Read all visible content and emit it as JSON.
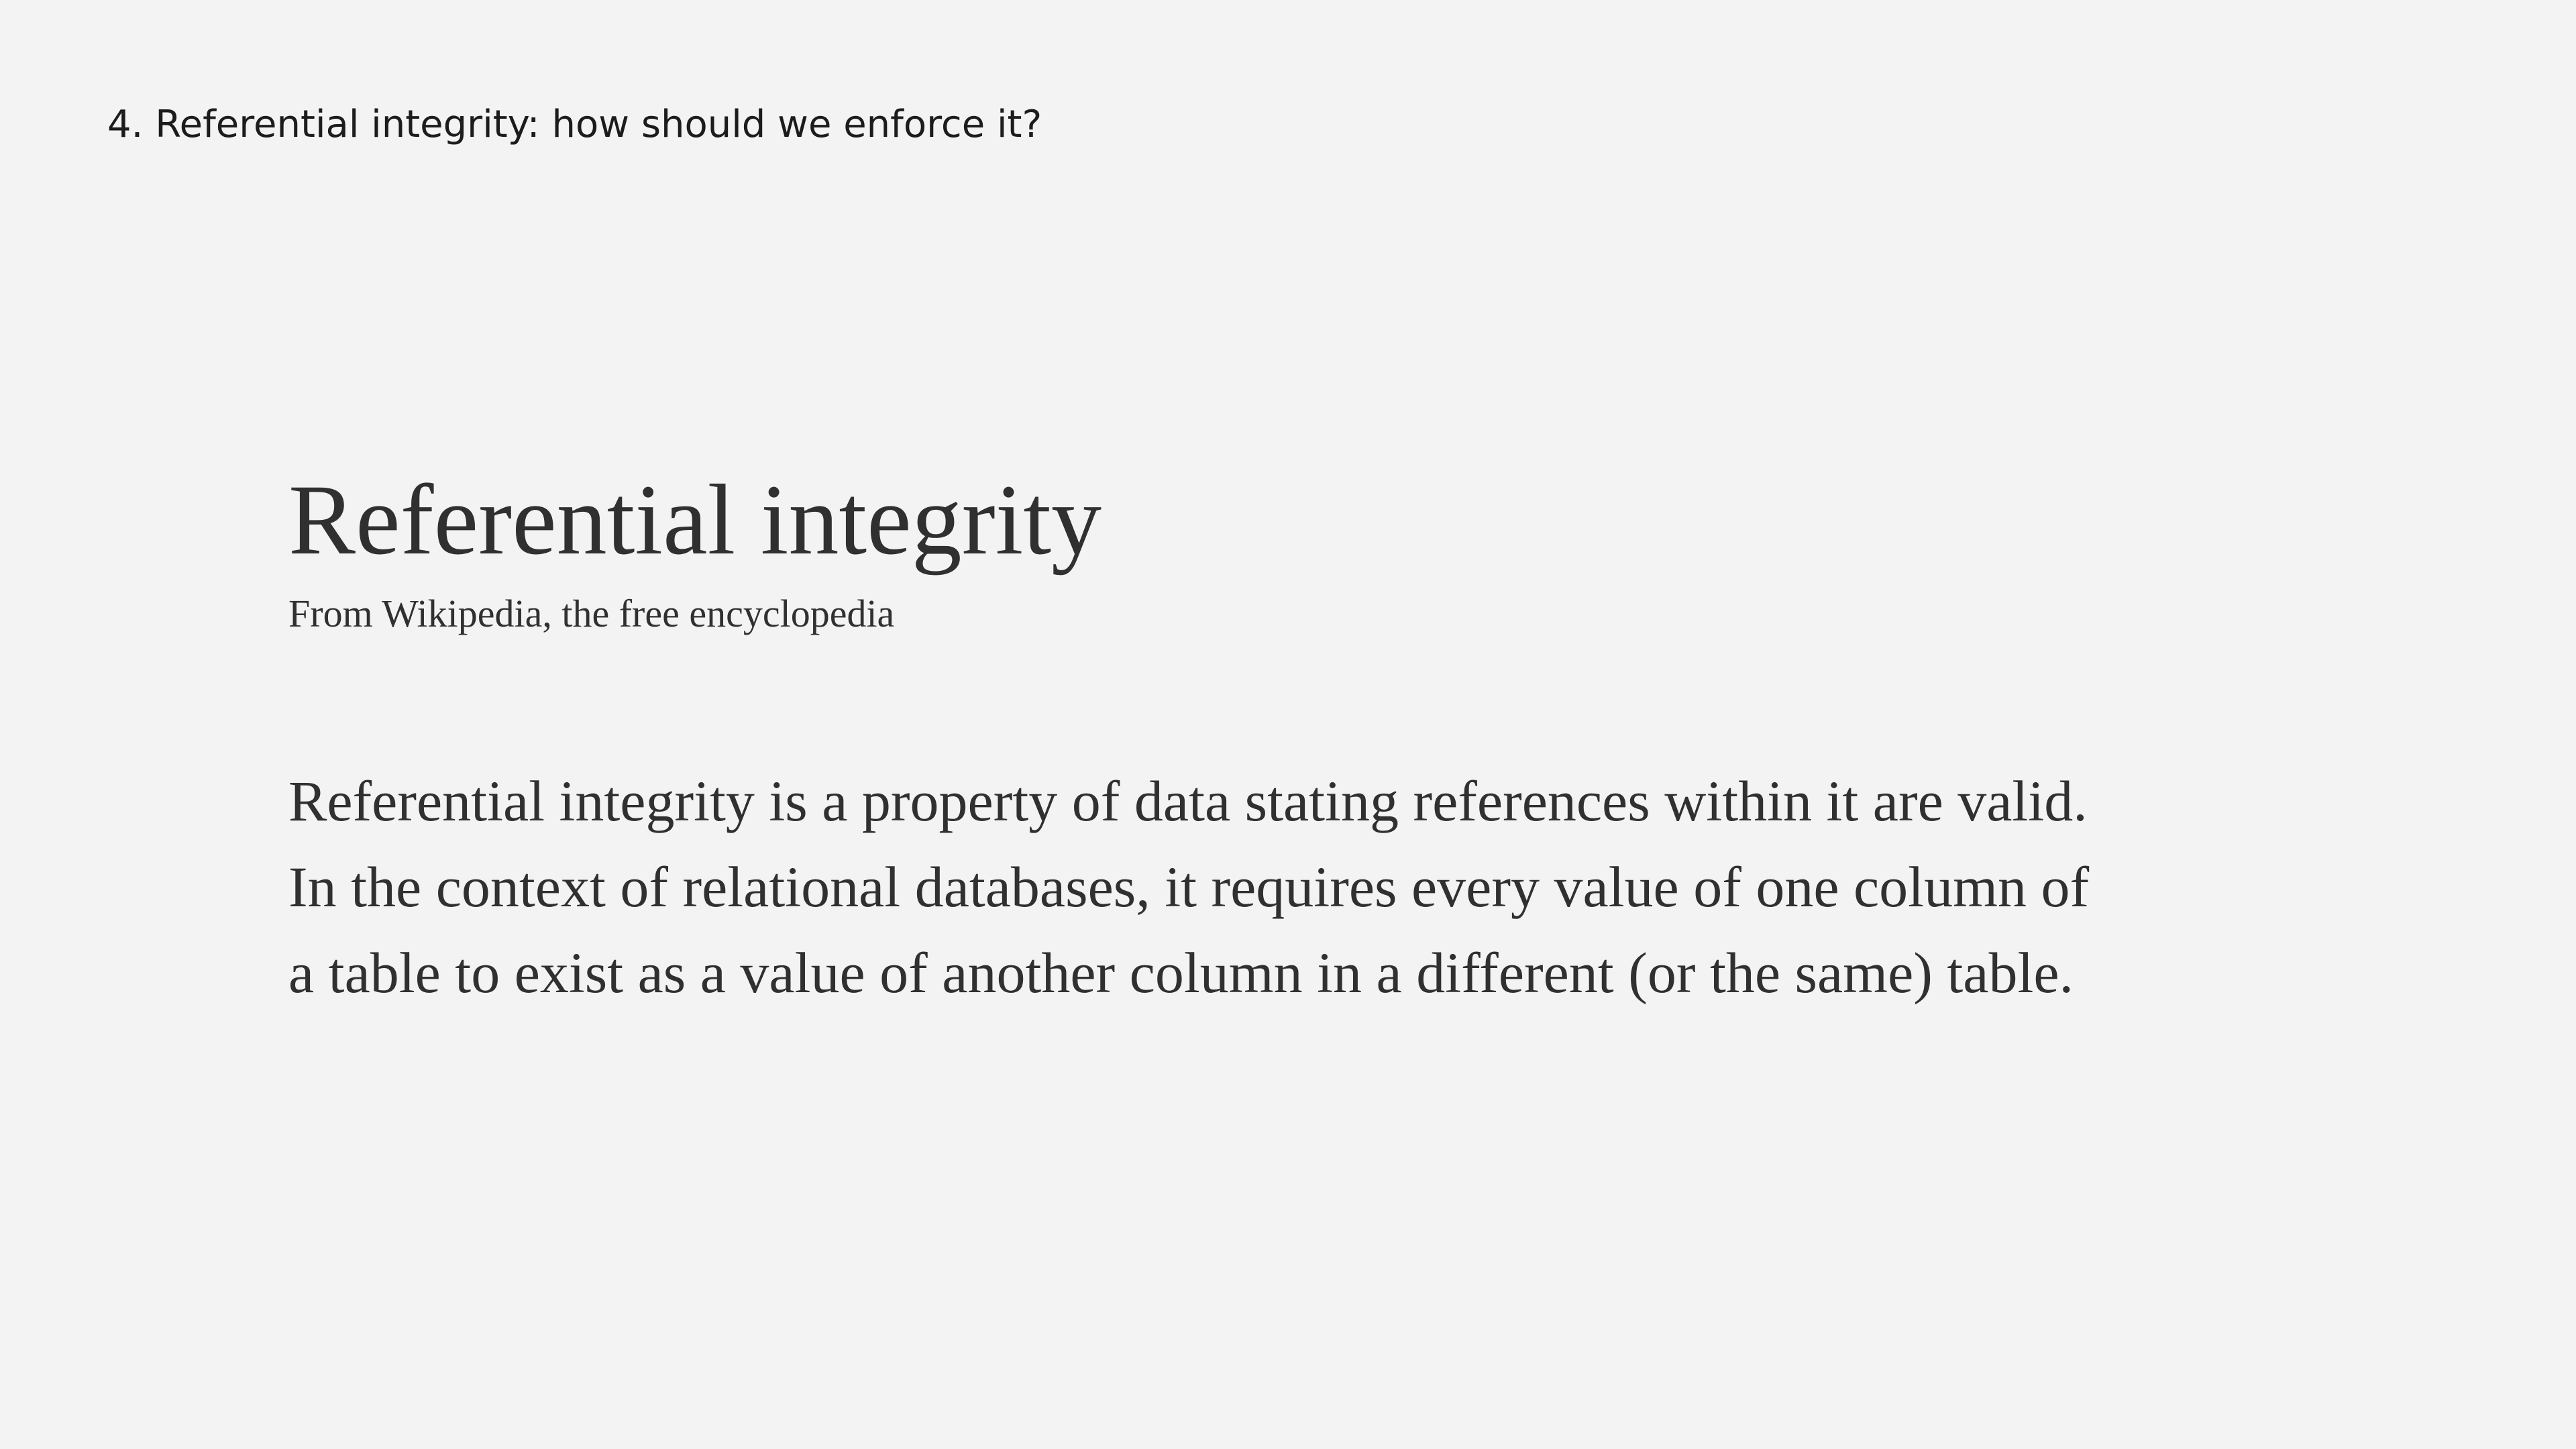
{
  "slide": {
    "header": "4. Referential integrity: how should we enforce it?"
  },
  "article": {
    "title": "Referential integrity",
    "source": "From Wikipedia, the free encyclopedia",
    "body_lines": [
      "Referential integrity is a property of data stating references within it are valid.",
      "In the context of relational databases, it requires every value of one column of",
      "a table to exist as a value of another column in a different (or the same) table."
    ]
  }
}
